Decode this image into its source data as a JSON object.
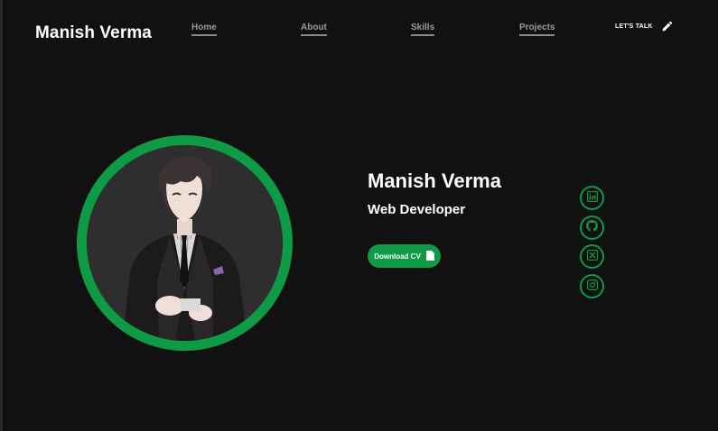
{
  "header": {
    "brand": "Manish Verma",
    "nav": {
      "home": "Home",
      "about": "About",
      "skills": "Skills",
      "projects": "Projects"
    },
    "cta_label": "LET'S TALK",
    "cta_icon": "pencil-icon"
  },
  "hero": {
    "name": "Manish Verma",
    "role": "Web Developer",
    "cv_button": "Download CV",
    "cv_icon": "document-icon"
  },
  "social": [
    {
      "icon": "linkedin-icon"
    },
    {
      "icon": "github-icon"
    },
    {
      "icon": "x-icon"
    },
    {
      "icon": "instagram-icon"
    }
  ],
  "colors": {
    "background": "#111111",
    "accent": "#0f9a45",
    "nav_text": "#9a9a9a",
    "text": "#ffffff"
  }
}
